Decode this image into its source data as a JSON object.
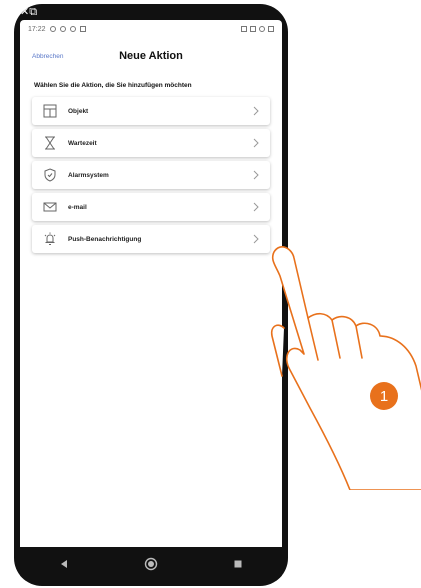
{
  "device": {
    "corner_label": "✕⧉"
  },
  "status_bar": {
    "time": "17:22"
  },
  "header": {
    "cancel_label": "Abbrechen",
    "title": "Neue Aktion"
  },
  "subtitle": "Wählen Sie die Aktion, die Sie hinzufügen möchten",
  "actions": [
    {
      "label": "Objekt",
      "icon": "object-grid-icon"
    },
    {
      "label": "Wartezeit",
      "icon": "hourglass-icon"
    },
    {
      "label": "Alarmsystem",
      "icon": "shield-icon"
    },
    {
      "label": "e-mail",
      "icon": "envelope-icon"
    },
    {
      "label": "Push-Benachrichtigung",
      "icon": "bell-icon"
    }
  ],
  "callout": {
    "number": "1"
  },
  "colors": {
    "accent": "#5a78c8",
    "callout": "#e8711c",
    "hand_stroke": "#e8711c"
  }
}
